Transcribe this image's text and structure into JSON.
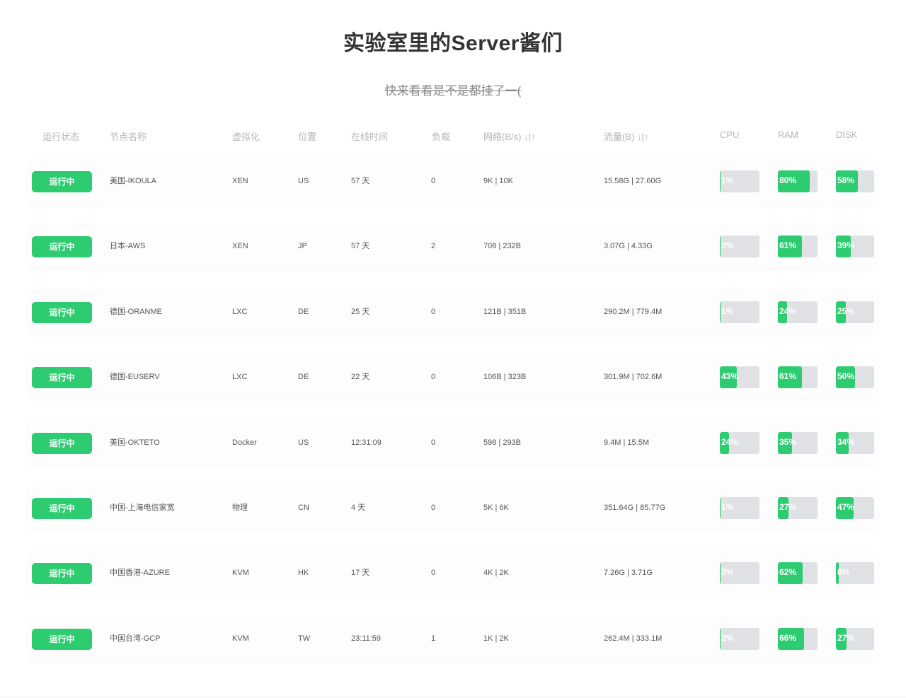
{
  "page": {
    "title": "实验室里的Server酱们",
    "subtitle": "快来看看是不是都挂了一("
  },
  "table": {
    "headers": {
      "status": "运行状态",
      "name": "节点名称",
      "virt": "虚拟化",
      "location": "位置",
      "uptime": "在线时间",
      "load": "负载",
      "network": "网络(B/s) ↓|↑",
      "traffic": "流量(B) ↓|↑",
      "cpu": "CPU",
      "ram": "RAM",
      "disk": "DISK"
    },
    "rows": [
      {
        "status": "运行中",
        "name": "美国-IKOULA",
        "virt": "XEN",
        "location": "US",
        "uptime": "57 天",
        "load": "0",
        "network": "9K | 10K",
        "traffic": "15.58G | 27.60G",
        "cpu": {
          "value": 1,
          "label": "1%"
        },
        "ram": {
          "value": 80,
          "label": "80%"
        },
        "disk": {
          "value": 58,
          "label": "58%"
        }
      },
      {
        "status": "运行中",
        "name": "日本-AWS",
        "virt": "XEN",
        "location": "JP",
        "uptime": "57 天",
        "load": "2",
        "network": "708 | 232B",
        "traffic": "3.07G | 4.33G",
        "cpu": {
          "value": 2,
          "label": "2%"
        },
        "ram": {
          "value": 61,
          "label": "61%"
        },
        "disk": {
          "value": 39,
          "label": "39%"
        }
      },
      {
        "status": "运行中",
        "name": "德国-ORANME",
        "virt": "LXC",
        "location": "DE",
        "uptime": "25 天",
        "load": "0",
        "network": "121B | 351B",
        "traffic": "290.2M | 779.4M",
        "cpu": {
          "value": 1,
          "label": "1%"
        },
        "ram": {
          "value": 24,
          "label": "24%"
        },
        "disk": {
          "value": 25,
          "label": "25%"
        }
      },
      {
        "status": "运行中",
        "name": "德国-EUSERV",
        "virt": "LXC",
        "location": "DE",
        "uptime": "22 天",
        "load": "0",
        "network": "106B | 323B",
        "traffic": "301.9M | 702.6M",
        "cpu": {
          "value": 43,
          "label": "43%"
        },
        "ram": {
          "value": 61,
          "label": "61%"
        },
        "disk": {
          "value": 50,
          "label": "50%"
        }
      },
      {
        "status": "运行中",
        "name": "美国-OKTETO",
        "virt": "Docker",
        "location": "US",
        "uptime": "12:31:09",
        "load": "0",
        "network": "598 | 293B",
        "traffic": "9.4M | 15.5M",
        "cpu": {
          "value": 24,
          "label": "24%"
        },
        "ram": {
          "value": 35,
          "label": "35%"
        },
        "disk": {
          "value": 34,
          "label": "34%"
        }
      },
      {
        "status": "运行中",
        "name": "中国-上海电信家宽",
        "virt": "物理",
        "location": "CN",
        "uptime": "4 天",
        "load": "0",
        "network": "5K | 6K",
        "traffic": "351.64G | 85.77G",
        "cpu": {
          "value": 1,
          "label": "1%"
        },
        "ram": {
          "value": 27,
          "label": "27%"
        },
        "disk": {
          "value": 47,
          "label": "47%"
        }
      },
      {
        "status": "运行中",
        "name": "中国香港-AZURE",
        "virt": "KVM",
        "location": "HK",
        "uptime": "17 天",
        "load": "0",
        "network": "4K | 2K",
        "traffic": "7.26G | 3.71G",
        "cpu": {
          "value": 2,
          "label": "2%"
        },
        "ram": {
          "value": 62,
          "label": "62%"
        },
        "disk": {
          "value": 8,
          "label": "8%"
        }
      },
      {
        "status": "运行中",
        "name": "中国台湾-GCP",
        "virt": "KVM",
        "location": "TW",
        "uptime": "23:11:59",
        "load": "1",
        "network": "1K | 2K",
        "traffic": "262.4M | 333.1M",
        "cpu": {
          "value": 2,
          "label": "2%"
        },
        "ram": {
          "value": 66,
          "label": "66%"
        },
        "disk": {
          "value": 27,
          "label": "27%"
        }
      }
    ]
  },
  "colors": {
    "status_ok": "#2ecc71",
    "bar_fill": "#2ecc71",
    "bar_track": "#dfe1e4"
  }
}
